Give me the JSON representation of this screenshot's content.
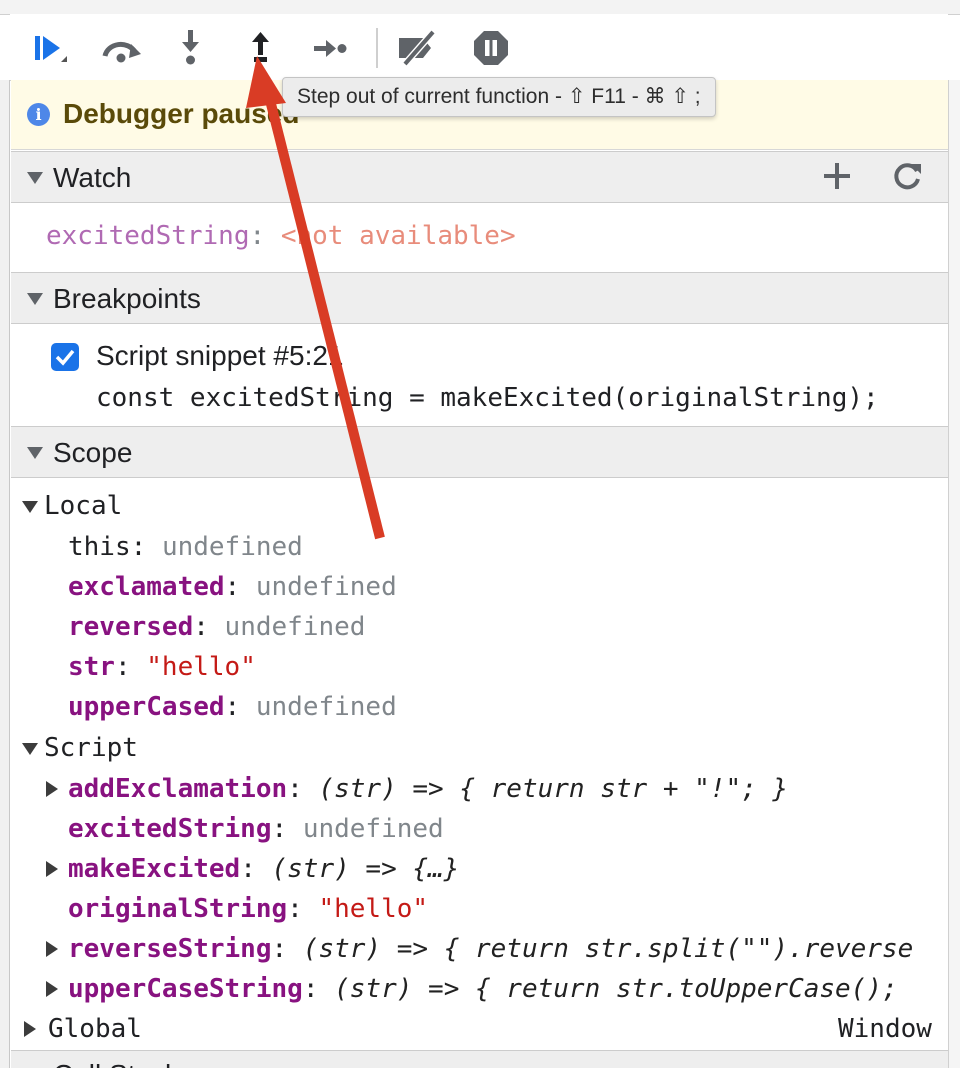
{
  "toolbar": {
    "buttons": [
      {
        "name": "resume-icon"
      },
      {
        "name": "step-over-icon"
      },
      {
        "name": "step-into-icon"
      },
      {
        "name": "step-out-icon"
      },
      {
        "name": "step-icon"
      },
      {
        "name": "deactivate-breakpoints-icon"
      },
      {
        "name": "pause-on-exceptions-icon"
      }
    ],
    "tooltip": "Step out of current function - ⇧ F11 - ⌘ ⇧ ;"
  },
  "paused_banner": {
    "icon": "info-icon",
    "message": "Debugger paused"
  },
  "watch": {
    "title": "Watch",
    "add_icon": "plus-icon",
    "refresh_icon": "refresh-icon",
    "expressions": [
      {
        "name": "excitedString",
        "value": "<not available>"
      }
    ]
  },
  "breakpoints": {
    "title": "Breakpoints",
    "items": [
      {
        "checked": true,
        "location": "Script snippet #5:21",
        "code": "const excitedString = makeExcited(originalString);"
      }
    ]
  },
  "scope": {
    "title": "Scope",
    "local": {
      "title": "Local",
      "vars": [
        {
          "name": "this",
          "value": "undefined"
        },
        {
          "name": "exclamated",
          "value": "undefined"
        },
        {
          "name": "reversed",
          "value": "undefined"
        },
        {
          "name": "str",
          "value": "\"hello\""
        },
        {
          "name": "upperCased",
          "value": "undefined"
        }
      ]
    },
    "script": {
      "title": "Script",
      "vars": [
        {
          "name": "addExclamation",
          "value": "(str) => { return str + \"!\"; }"
        },
        {
          "name": "excitedString",
          "value": "undefined"
        },
        {
          "name": "makeExcited",
          "value": "(str) => {…}"
        },
        {
          "name": "originalString",
          "value": "\"hello\""
        },
        {
          "name": "reverseString",
          "value": "(str) => { return str.split(\"\").reverse"
        },
        {
          "name": "upperCaseString",
          "value": "(str) => { return str.toUpperCase();"
        }
      ]
    },
    "global": {
      "title": "Global",
      "value": "Window"
    }
  },
  "next_section": {
    "title": "Call Stack"
  },
  "colors": {
    "accent": "#1a73e8",
    "annotation_arrow": "#d93c25",
    "paused_bg": "#fffbe6"
  }
}
